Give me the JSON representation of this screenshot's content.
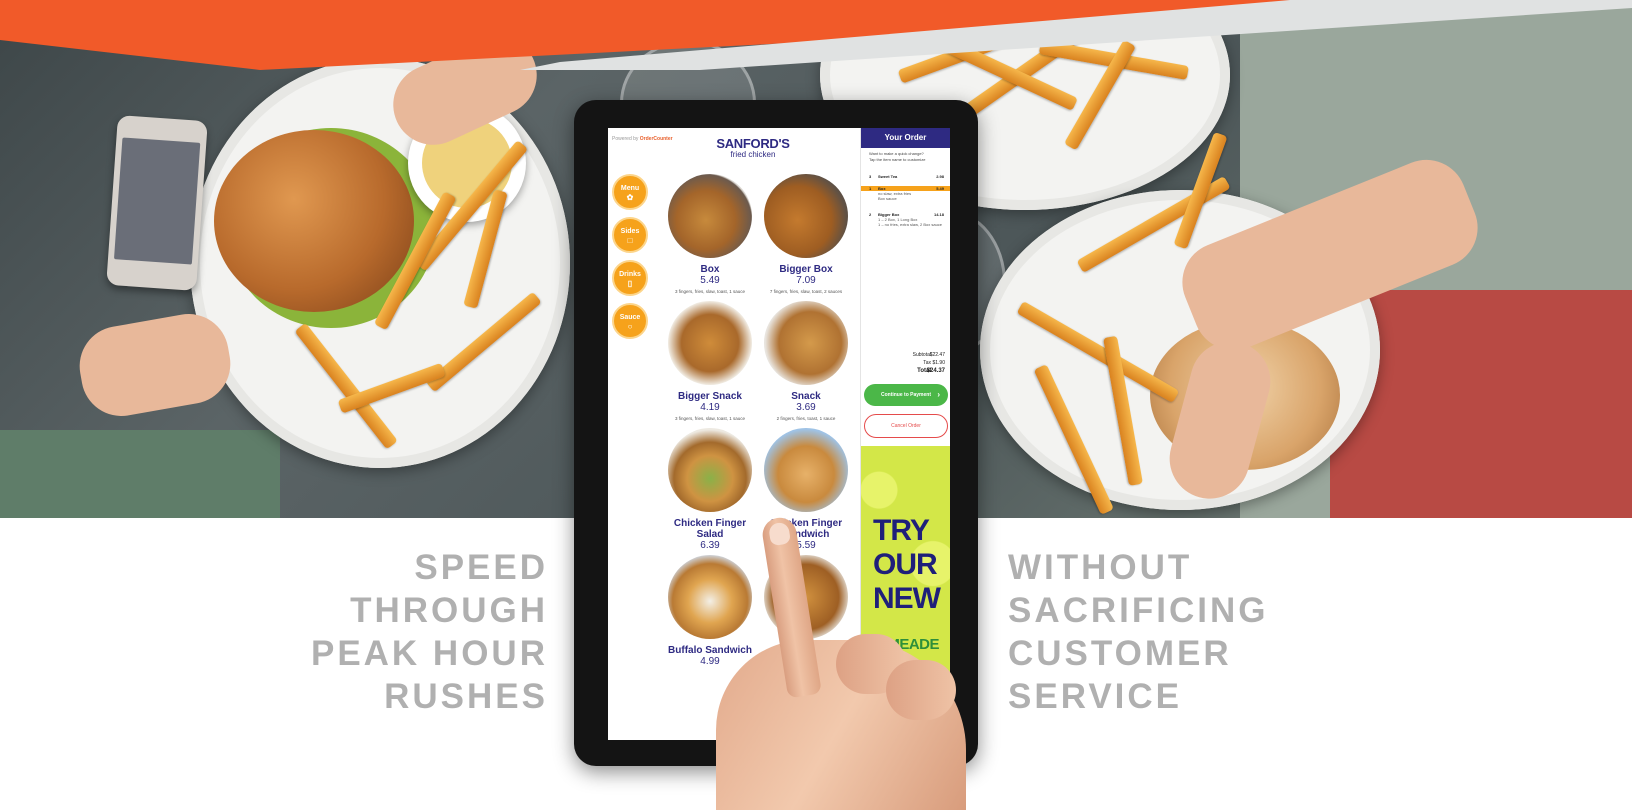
{
  "headline_left": [
    "SPEED",
    "THROUGH",
    "PEAK HOUR",
    "RUSHES"
  ],
  "headline_right": [
    "WITHOUT",
    "SACRIFICING",
    "CUSTOMER",
    "SERVICE"
  ],
  "kiosk": {
    "powered_by": "Powered by",
    "powered_brand": "OrderCounter",
    "brand_name": "SANFORD'S",
    "brand_sub": "fried chicken",
    "nav": [
      {
        "label": "Menu",
        "icon": "chicken-icon"
      },
      {
        "label": "Sides",
        "icon": "side-dish-icon"
      },
      {
        "label": "Drinks",
        "icon": "cup-icon"
      },
      {
        "label": "Sauce",
        "icon": "sauce-icon"
      }
    ],
    "items": [
      {
        "name": "Box",
        "price": "5.49",
        "desc": "3 fingers, fries, slaw, toast, 1 sauce"
      },
      {
        "name": "Bigger Box",
        "price": "7.09",
        "desc": "7 fingers, fries, slaw, toast, 2 sauces"
      },
      {
        "name": "Bigger Snack",
        "price": "4.19",
        "desc": "3 fingers, fries, slaw, toast, 1 sauce"
      },
      {
        "name": "Snack",
        "price": "3.69",
        "desc": "2 fingers, fries, toast, 1 sauce"
      },
      {
        "name": "Chicken Finger Salad",
        "price": "6.39",
        "desc": ""
      },
      {
        "name": "Chicken Finger Sandwich",
        "price": "5.59",
        "desc": ""
      },
      {
        "name": "Buffalo Sandwich",
        "price": "4.99",
        "desc": ""
      }
    ],
    "order": {
      "title": "Your Order",
      "hint_line1": "Want to make a quick change?",
      "hint_line2": "Tap the item name to customize",
      "lines": [
        {
          "qty": "3",
          "name": "Sweet Tea",
          "price": "2.98",
          "detail1": "",
          "detail2": ""
        },
        {
          "qty": "1",
          "name": "Box",
          "price": "5.49",
          "detail1": "no slaw, extra fries",
          "detail2": "Box sauce"
        },
        {
          "qty": "2",
          "name": "Bigger Box",
          "price": "14.18",
          "detail1": "1 – 2 Box, 1 Long Box",
          "detail2": "1 – no fries, extra slaw, 2 Box sauce"
        }
      ],
      "subtotal_label": "Subtotal",
      "subtotal": "$22.47",
      "tax_label": "Tax",
      "tax": "$1.90",
      "total_label": "Total",
      "total": "$24.37",
      "pay_label": "Continue to Payment",
      "cancel_label": "Cancel Order"
    },
    "promo": {
      "lines": [
        "TRY",
        "OUR",
        "NEW"
      ],
      "product": "LIMEADE"
    }
  },
  "colors": {
    "brand_blue": "#2e2a82",
    "accent_orange": "#f15a29",
    "nav_orange": "#f6a21b",
    "pay_green": "#4bb748",
    "cancel_red": "#e54b4b",
    "headline_gray": "#b0b0b0"
  }
}
